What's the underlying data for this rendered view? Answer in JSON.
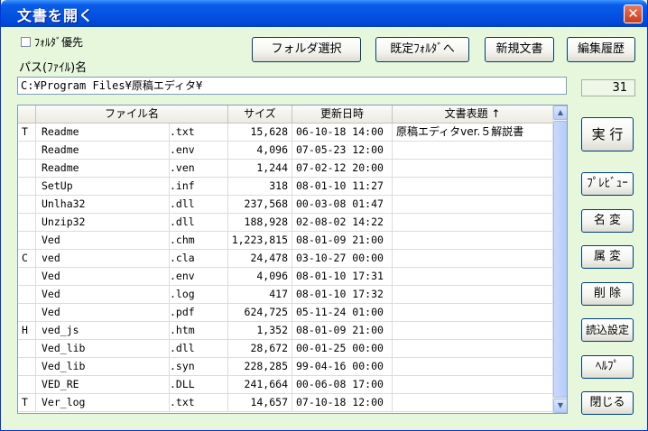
{
  "window": {
    "title": "文書を開く",
    "close_label": "✕"
  },
  "options": {
    "folder_priority_label": "ﾌｫﾙﾀﾞ優先",
    "folder_priority_checked": false
  },
  "toolbar": {
    "select_folder": "フォルダ選択",
    "default_folder": "既定ﾌｫﾙﾀﾞへ",
    "new_document": "新規文書",
    "edit_history": "編集履歴"
  },
  "path": {
    "label": "パス(ﾌｧｲﾙ)名",
    "value": "C:¥Program Files¥原稿エディタ¥"
  },
  "file_count": "31",
  "list": {
    "columns": [
      "",
      "ファイル名",
      "サイズ",
      "更新日時",
      "文書表題 ↑"
    ],
    "rows": [
      {
        "mark": "T",
        "name": "Readme",
        "ext": ".txt",
        "size": "15,628",
        "date": "06-10-18 14:00",
        "title": "原稿エディタver.５解説書"
      },
      {
        "mark": "",
        "name": "Readme",
        "ext": ".env",
        "size": "4,096",
        "date": "07-05-23 12:00",
        "title": ""
      },
      {
        "mark": "",
        "name": "Readme",
        "ext": ".ven",
        "size": "1,244",
        "date": "07-02-12 20:00",
        "title": ""
      },
      {
        "mark": "",
        "name": "SetUp",
        "ext": ".inf",
        "size": "318",
        "date": "08-01-10 11:27",
        "title": ""
      },
      {
        "mark": "",
        "name": "Unlha32",
        "ext": ".dll",
        "size": "237,568",
        "date": "00-03-08 01:47",
        "title": ""
      },
      {
        "mark": "",
        "name": "Unzip32",
        "ext": ".dll",
        "size": "188,928",
        "date": "02-08-02 14:22",
        "title": ""
      },
      {
        "mark": "",
        "name": "Ved",
        "ext": ".chm",
        "size": "1,223,815",
        "date": "08-01-09 21:00",
        "title": ""
      },
      {
        "mark": "C",
        "name": "ved",
        "ext": ".cla",
        "size": "24,478",
        "date": "03-10-27 00:00",
        "title": ""
      },
      {
        "mark": "",
        "name": "Ved",
        "ext": ".env",
        "size": "4,096",
        "date": "08-01-10 17:31",
        "title": ""
      },
      {
        "mark": "",
        "name": "Ved",
        "ext": ".log",
        "size": "417",
        "date": "08-01-10 17:32",
        "title": ""
      },
      {
        "mark": "",
        "name": "Ved",
        "ext": ".pdf",
        "size": "624,725",
        "date": "05-11-24 01:00",
        "title": ""
      },
      {
        "mark": "H",
        "name": "ved_js",
        "ext": ".htm",
        "size": "1,352",
        "date": "08-01-09 21:00",
        "title": ""
      },
      {
        "mark": "",
        "name": "Ved_lib",
        "ext": ".dll",
        "size": "28,672",
        "date": "00-01-25 00:00",
        "title": ""
      },
      {
        "mark": "",
        "name": "Ved_lib",
        "ext": ".syn",
        "size": "228,285",
        "date": "99-04-16 00:00",
        "title": ""
      },
      {
        "mark": "",
        "name": "VED_RE",
        "ext": ".DLL",
        "size": "241,664",
        "date": "00-06-08 17:00",
        "title": ""
      },
      {
        "mark": "T",
        "name": "Ver_log",
        "ext": ".txt",
        "size": "14,657",
        "date": "07-10-18 12:00",
        "title": ""
      }
    ]
  },
  "side": {
    "execute": "実 行",
    "preview": "ﾌﾟﾚﾋﾞｭｰ",
    "rename": "名 変",
    "attributes": "属 変",
    "delete": "削 除",
    "load_settings": "読込設定",
    "help": "ﾍﾙﾌﾟ",
    "close": "閉じる"
  },
  "colors": {
    "window_bg": "#e6f7dc",
    "titlebar": "#0554e3",
    "close": "#c93d1a"
  },
  "icons": {
    "scroll_up": "up-arrow-icon",
    "scroll_down": "down-arrow-icon"
  }
}
